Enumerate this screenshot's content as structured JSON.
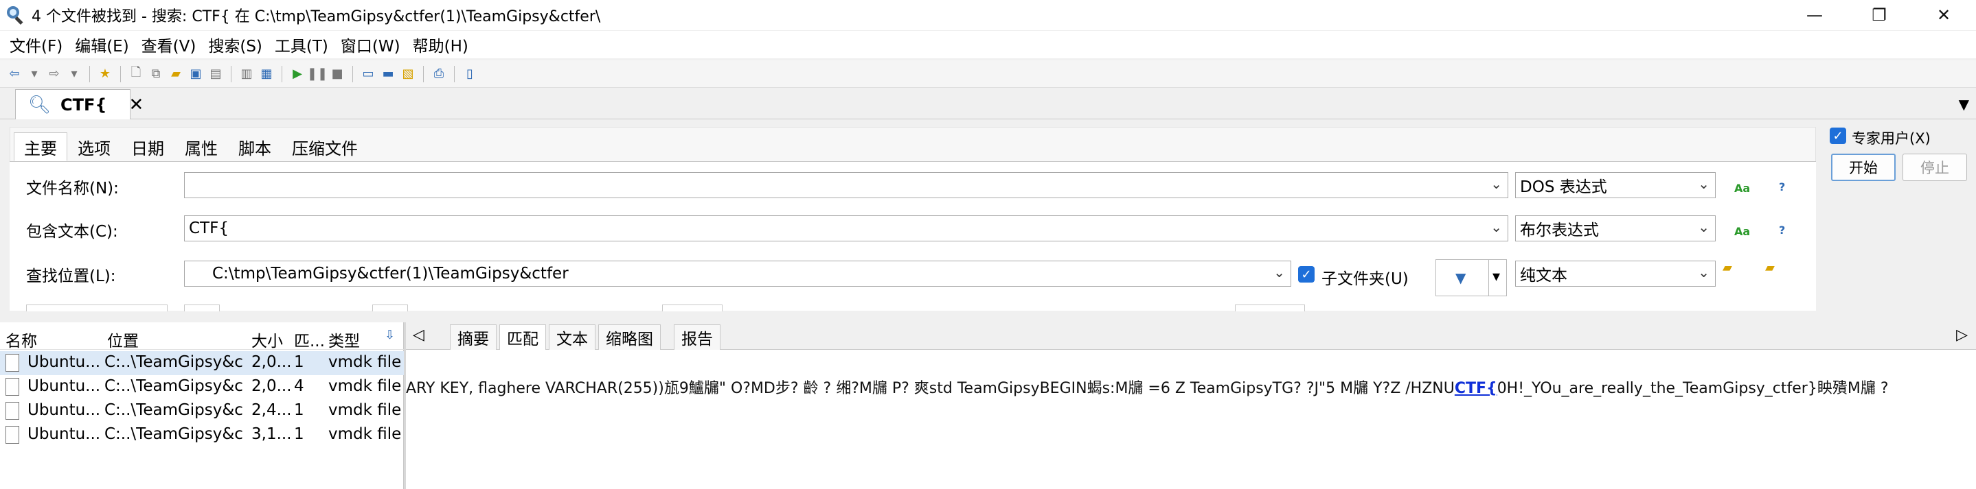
{
  "window": {
    "title": "4 个文件被找到 - 搜索: CTF{ 在 C:\\tmp\\TeamGipsy&ctfer(1)\\TeamGipsy&ctfer\\"
  },
  "window_controls": {
    "minimize": "—",
    "maximize": "❐",
    "close": "✕"
  },
  "menu": [
    "文件(F)",
    "编辑(E)",
    "查看(V)",
    "搜索(S)",
    "工具(T)",
    "窗口(W)",
    "帮助(H)"
  ],
  "document_tab": {
    "label": "CTF{",
    "close": "✕"
  },
  "search_tabs": [
    "主要",
    "选项",
    "日期",
    "属性",
    "脚本",
    "压缩文件"
  ],
  "form": {
    "filename_label": "文件名称(N):",
    "filename_value": "",
    "filename_mode": "DOS 表达式",
    "contains_label": "包含文本(C):",
    "contains_value": "CTF{",
    "contains_mode": "布尔表达式",
    "location_label": "查找位置(L):",
    "location_value": "C:\\tmp\\TeamGipsy&ctfer(1)\\TeamGipsy&ctfer",
    "subfolders_label": "子文件夹(U)",
    "subfolders_checked": true,
    "location_mode": "纯文本",
    "aa_icon": "Aa",
    "help_icon": "?"
  },
  "expert": {
    "label": "专家用户(X)",
    "checked": true
  },
  "buttons": {
    "start": "开始",
    "stop": "停止"
  },
  "results": {
    "columns": [
      "名称",
      "位置",
      "大小",
      "匹...",
      "类型"
    ],
    "rows": [
      {
        "name": "Ubuntu...",
        "location": "C:..\\TeamGipsy&c",
        "size": "2,0...",
        "matches": "1",
        "type": "vmdk file",
        "selected": true
      },
      {
        "name": "Ubuntu...",
        "location": "C:..\\TeamGipsy&c",
        "size": "2,0...",
        "matches": "4",
        "type": "vmdk file",
        "selected": false
      },
      {
        "name": "Ubuntu...",
        "location": "C:..\\TeamGipsy&c",
        "size": "2,4...",
        "matches": "1",
        "type": "vmdk file",
        "selected": false
      },
      {
        "name": "Ubuntu...",
        "location": "C:..\\TeamGipsy&c",
        "size": "3,1...",
        "matches": "1",
        "type": "vmdk file",
        "selected": false
      }
    ]
  },
  "preview_tabs": [
    "摘要",
    "匹配",
    "文本",
    "缩略图",
    "报告"
  ],
  "preview_active_tab": "匹配",
  "preview": {
    "before": "ARY KEY, flaghere VARCHAR(255))瓬9鱸牖\" O?MD步? 齡 ? 缃?M牖  P?   爽std        TeamGipsyBEGIN蝎s:M牖  =6 Z TeamGipsyTG? ?J\"5 M牖  Y?Z    /HZNU",
    "match": "CTF{",
    "after": "0H!_YOu_are_really_the_TeamGipsy_ctfer}眏殨M牖  ?"
  }
}
